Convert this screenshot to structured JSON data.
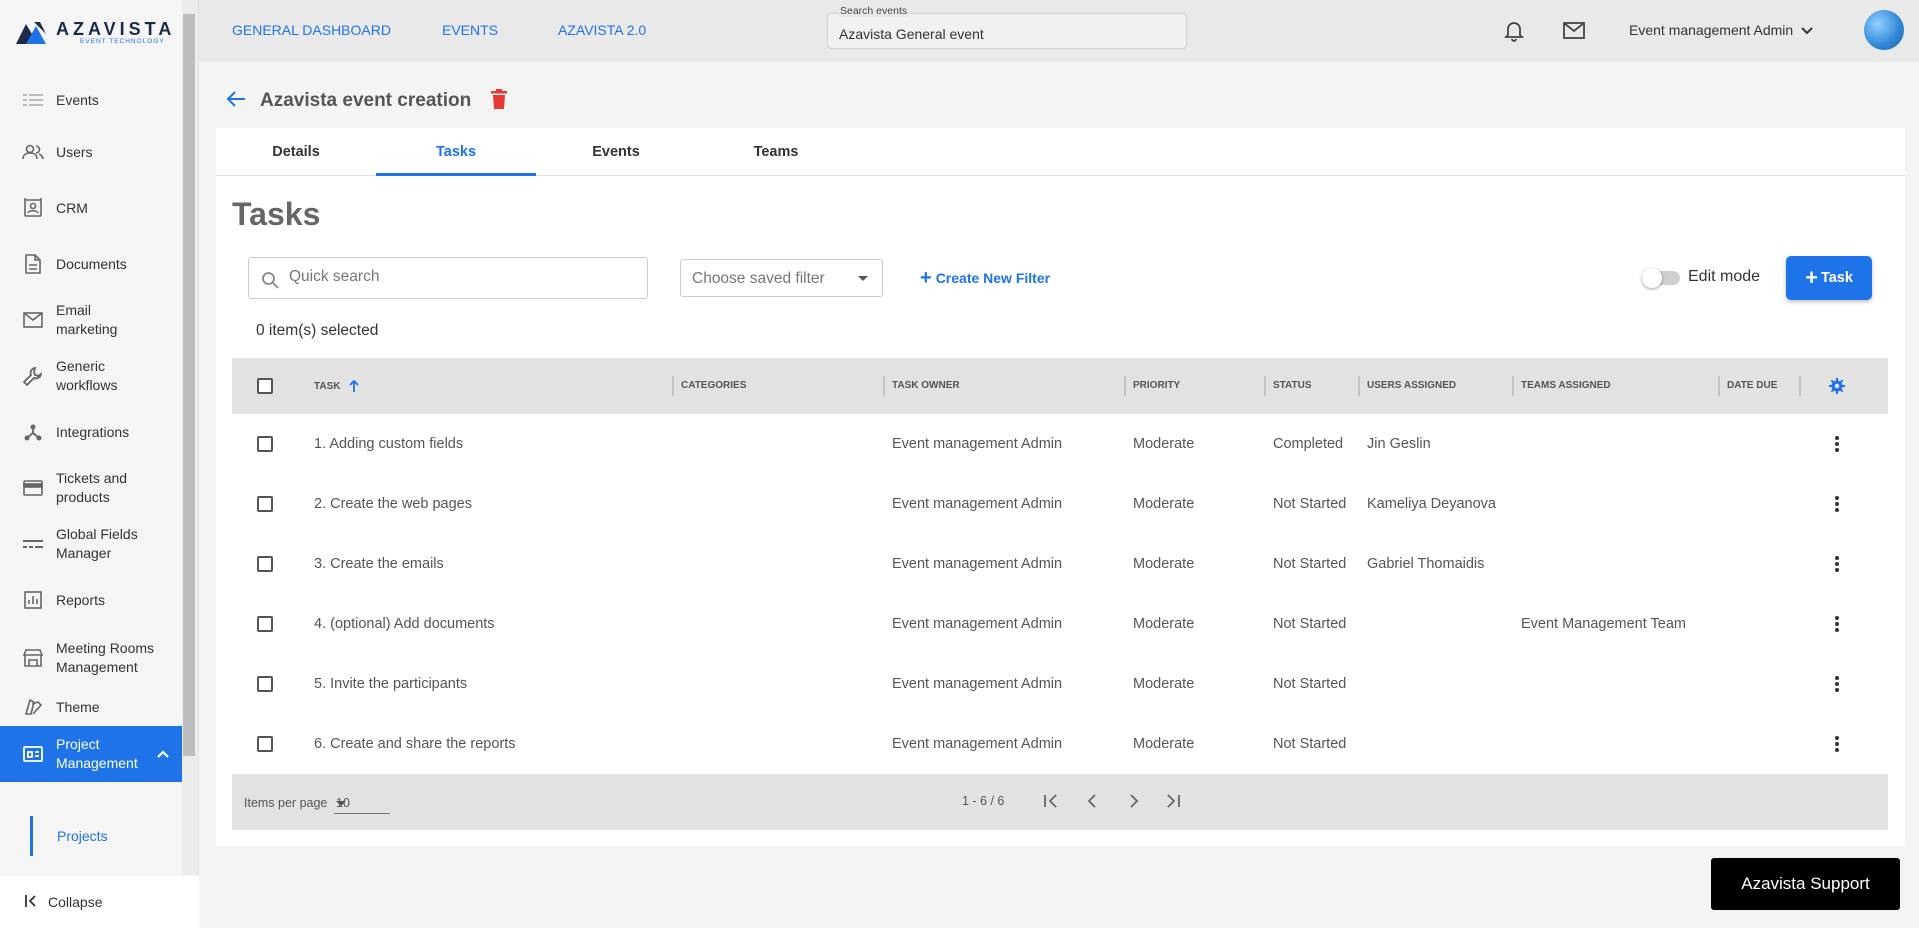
{
  "logo": {
    "wordmark": "AZAVISTA",
    "tagline": "EVENT TECHNOLOGY"
  },
  "topnav": {
    "items": [
      "GENERAL DASHBOARD",
      "EVENTS",
      "AZAVISTA 2.0"
    ]
  },
  "search": {
    "label": "Search events",
    "value": "Azavista General event"
  },
  "user": {
    "name": "Event management Admin"
  },
  "sidebar": {
    "items": [
      {
        "label": "Events",
        "icon": "list-icon"
      },
      {
        "label": "Users",
        "icon": "users-icon"
      },
      {
        "label": "CRM",
        "icon": "contact-card-icon"
      },
      {
        "label": "Documents",
        "icon": "document-icon"
      },
      {
        "label": "Email marketing",
        "icon": "mail-icon"
      },
      {
        "label": "Generic workflows",
        "icon": "wrench-icon"
      },
      {
        "label": "Integrations",
        "icon": "integrations-icon"
      },
      {
        "label": "Tickets and products",
        "icon": "card-icon"
      },
      {
        "label": "Global Fields Manager",
        "icon": "fields-icon"
      },
      {
        "label": "Reports",
        "icon": "bar-chart-icon"
      },
      {
        "label": "Meeting Rooms Management",
        "icon": "store-icon"
      },
      {
        "label": "Theme",
        "icon": "palette-icon"
      },
      {
        "label": "Project Management",
        "icon": "project-icon"
      }
    ],
    "sub_item": "Projects",
    "collapse": "Collapse"
  },
  "page": {
    "title": "Azavista event creation",
    "heading": "Tasks"
  },
  "tabs": [
    "Details",
    "Tasks",
    "Events",
    "Teams"
  ],
  "toolbar": {
    "search_placeholder": "Quick search",
    "filter_placeholder": "Choose saved filter",
    "new_filter": "Create New Filter",
    "edit_mode": "Edit mode",
    "add_task": "Task",
    "selected": "0 item(s) selected"
  },
  "table": {
    "headers": [
      "TASK",
      "CATEGORIES",
      "TASK OWNER",
      "PRIORITY",
      "STATUS",
      "USERS ASSIGNED",
      "TEAMS ASSIGNED",
      "DATE DUE"
    ],
    "rows": [
      {
        "task": "1. Adding custom fields",
        "categories": "",
        "owner": "Event management Admin",
        "priority": "Moderate",
        "status": "Completed",
        "users": "Jin Geslin",
        "teams": "",
        "due": ""
      },
      {
        "task": "2. Create the web pages",
        "categories": "",
        "owner": "Event management Admin",
        "priority": "Moderate",
        "status": "Not Started",
        "users": "Kameliya Deyanova",
        "teams": "",
        "due": ""
      },
      {
        "task": "3. Create the emails",
        "categories": "",
        "owner": "Event management Admin",
        "priority": "Moderate",
        "status": "Not Started",
        "users": "Gabriel Thomaidis",
        "teams": "",
        "due": ""
      },
      {
        "task": "4. (optional) Add documents",
        "categories": "",
        "owner": "Event management Admin",
        "priority": "Moderate",
        "status": "Not Started",
        "users": "",
        "teams": "Event Management Team",
        "due": ""
      },
      {
        "task": "5. Invite the participants",
        "categories": "",
        "owner": "Event management Admin",
        "priority": "Moderate",
        "status": "Not Started",
        "users": "",
        "teams": "",
        "due": ""
      },
      {
        "task": "6. Create and share the reports",
        "categories": "",
        "owner": "Event management Admin",
        "priority": "Moderate",
        "status": "Not Started",
        "users": "",
        "teams": "",
        "due": ""
      }
    ],
    "footer": {
      "items_per_page_label": "Items per page",
      "items_per_page": "10",
      "range": "1 - 6 / 6"
    }
  },
  "support": "Azavista Support",
  "colors": {
    "accent": "#1f73e8",
    "delete": "#e53935",
    "support_bg": "#000000"
  }
}
